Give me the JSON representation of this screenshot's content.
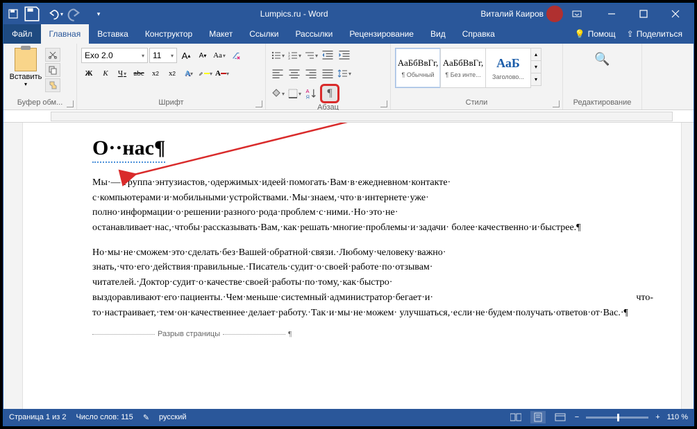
{
  "title": "Lumpics.ru  -  Word",
  "user": "Виталий Каиров",
  "menu": {
    "file": "Файл",
    "home": "Главная",
    "insert": "Вставка",
    "design": "Конструктор",
    "layout": "Макет",
    "references": "Ссылки",
    "mailings": "Рассылки",
    "review": "Рецензирование",
    "view": "Вид",
    "help": "Справка",
    "tellme": "Помощ",
    "share": "Поделиться"
  },
  "chunks": {
    "clipboard": "Буфер обм...",
    "font": "Шрифт",
    "paragraph": "Абзац",
    "styles": "Стили",
    "editing": "Редактирование"
  },
  "paste": "Вставить",
  "font": {
    "name": "Exo 2.0",
    "size": "11"
  },
  "styles": [
    {
      "preview": "АаБбВвГг,",
      "name": "¶ Обычный"
    },
    {
      "preview": "АаБбВвГг,",
      "name": "¶ Без инте..."
    },
    {
      "preview": "АаБ",
      "name": "Заголово..."
    }
  ],
  "document": {
    "heading": "О··нас¶",
    "p1": "Мы·—·группа·энтузиастов,·одержимых·идеей·помогать·Вам·в·ежедневном·контакте· с·компьютерами·и·мобильными·устройствами.·Мы·знаем,·что·в·интернете·уже· полно·информации·о·решении·разного·рода·проблем·с·ними.·Но·это·не· останавливает·нас,·чтобы·рассказывать·Вам,·как·решать·многие·проблемы·и·задачи· более·качественно·и·быстрее.¶",
    "p2": "Но·мы·не·сможем·это·сделать·без·Вашей·обратной·связи.·Любому·человеку·важно· знать,·что·его·действия·правильные.·Писатель·судит·о·своей·работе·по·отзывам· читателей.·Доктор·судит·о·качестве·своей·работы·по·тому,·как·быстро· выздоравливают·его·пациенты.·Чем·меньше·системный·администратор·бегает·и· что-то·настраивает,·тем·он·качественнее·делает·работу.·Так·и·мы·не·можем· улучшаться,·если·не·будем·получать·ответов·от·Вас.·¶",
    "pagebreak": "Разрыв страницы"
  },
  "status": {
    "page": "Страница 1 из 2",
    "words": "Число слов: 115",
    "lang": "русский",
    "zoom": "110 %"
  }
}
